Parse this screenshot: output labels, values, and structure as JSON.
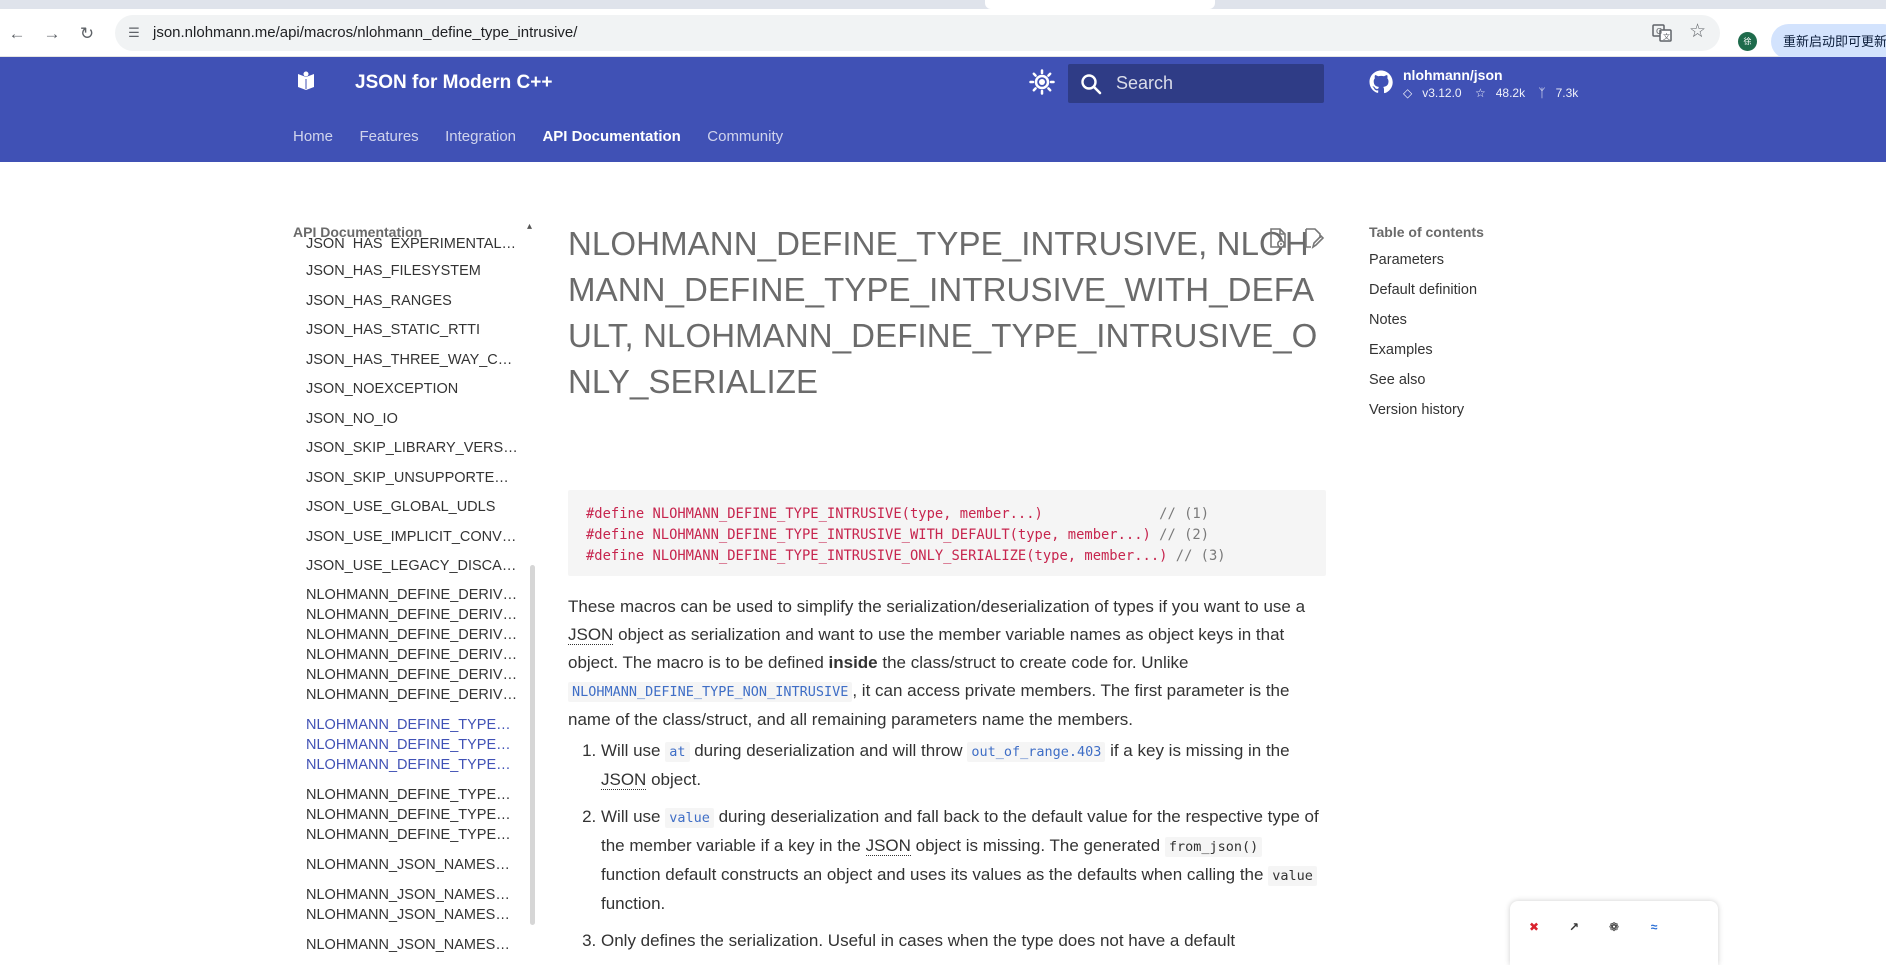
{
  "browser": {
    "url": "json.nlohmann.me/api/macros/nlohmann_define_type_intrusive/",
    "profile_initial": "徐",
    "update_button": "重新启动即可更新"
  },
  "header": {
    "site_title": "JSON for Modern C++",
    "search_placeholder": "Search",
    "repo_name": "nlohmann/json",
    "repo_version": "v3.12.0",
    "repo_stars": "48.2k",
    "repo_forks": "7.3k",
    "tabs": [
      "Home",
      "Features",
      "Integration",
      "API Documentation",
      "Community"
    ],
    "active_tab": "API Documentation"
  },
  "nav": {
    "title": "API Documentation",
    "items": [
      {
        "label": "JSON_HAS_EXPERIMENTAL_FILESYSTEM",
        "current": false
      },
      {
        "label": "JSON_HAS_FILESYSTEM",
        "current": false
      },
      {
        "label": "JSON_HAS_RANGES",
        "current": false
      },
      {
        "label": "JSON_HAS_STATIC_RTTI",
        "current": false
      },
      {
        "label": "JSON_HAS_THREE_WAY_COMPARISON",
        "current": false
      },
      {
        "label": "JSON_NOEXCEPTION",
        "current": false
      },
      {
        "label": "JSON_NO_IO",
        "current": false
      },
      {
        "label": "JSON_SKIP_LIBRARY_VERSION_CHECK",
        "current": false
      },
      {
        "label": "JSON_SKIP_UNSUPPORTED_COMPILER_CHECK",
        "current": false
      },
      {
        "label": "JSON_USE_GLOBAL_UDLS",
        "current": false
      },
      {
        "label": "JSON_USE_IMPLICIT_CONVERSIONS",
        "current": false
      },
      {
        "label": "JSON_USE_LEGACY_DISCARDED_VALUE_COMPARISON",
        "current": false
      },
      {
        "label": "NLOHMANN_DEFINE_DERIVED_TYPE_INTRUSIVE",
        "current": false
      },
      {
        "label": "NLOHMANN_DEFINE_DERIVED_TYPE_INTRUSIVE_WITH_DEFAULT",
        "current": false
      },
      {
        "label": "NLOHMANN_DEFINE_DERIVED_TYPE_INTRUSIVE_ONLY_SERIALIZE",
        "current": false
      },
      {
        "label": "NLOHMANN_DEFINE_DERIVED_TYPE_NON_INTRUSIVE",
        "current": false
      },
      {
        "label": "NLOHMANN_DEFINE_DERIVED_TYPE_NON_INTRUSIVE_WITH_DEFAULT",
        "current": false
      },
      {
        "label": "NLOHMANN_DEFINE_DERIVED_TYPE_NON_INTRUSIVE_ONLY_SERIALIZE",
        "current": false
      },
      {
        "label": "NLOHMANN_DEFINE_TYPE_INTRUSIVE",
        "current": true
      },
      {
        "label": "NLOHMANN_DEFINE_TYPE_INTRUSIVE_WITH_DEFAULT",
        "current": true
      },
      {
        "label": "NLOHMANN_DEFINE_TYPE_INTRUSIVE_ONLY_SERIALIZE",
        "current": true
      },
      {
        "label": "NLOHMANN_DEFINE_TYPE_NON_INTRUSIVE",
        "current": false
      },
      {
        "label": "NLOHMANN_DEFINE_TYPE_NON_INTRUSIVE_WITH_DEFAULT",
        "current": false
      },
      {
        "label": "NLOHMANN_DEFINE_TYPE_NON_INTRUSIVE_ONLY_SERIALIZE",
        "current": false
      },
      {
        "label": "NLOHMANN_JSON_NAMESPACE",
        "current": false
      },
      {
        "label": "NLOHMANN_JSON_NAMESPACE_BEGIN",
        "current": false
      },
      {
        "label": "NLOHMANN_JSON_NAMESPACE_END",
        "current": false
      },
      {
        "label": "NLOHMANN_JSON_NAMESPACE_NO_VERSION",
        "current": false
      }
    ]
  },
  "main": {
    "title": "NLOHMANN_DEFINE_TYPE_INTRUSIVE, NLOHMANN_DEFINE_TYPE_INTRUSIVE_WITH_DEFAULT, NLOHMANN_DEFINE_TYPE_INTRUSIVE_ONLY_SERIALIZE",
    "code_lines": [
      {
        "code": "#define NLOHMANN_DEFINE_TYPE_INTRUSIVE(type, member...)              ",
        "comment": "// (1)"
      },
      {
        "code": "#define NLOHMANN_DEFINE_TYPE_INTRUSIVE_WITH_DEFAULT(type, member...) ",
        "comment": "// (2)"
      },
      {
        "code": "#define NLOHMANN_DEFINE_TYPE_INTRUSIVE_ONLY_SERIALIZE(type, member...) ",
        "comment": "// (3)"
      }
    ],
    "intro": {
      "p1": "These macros can be used to simplify the serialization/deserialization of types if you want to use a ",
      "json1": "JSON",
      "p2": " object as serialization and want to use the member variable names as object keys in that object. The macro is to be defined ",
      "bold": "inside",
      "p3": " the class/struct to create code for. Unlike ",
      "code": "NLOHMANN_DEFINE_TYPE_NON_INTRUSIVE",
      "p4": ", it can access private members. The first parameter is the name of the class/struct, and all remaining parameters name the members."
    },
    "list": {
      "item1": {
        "a": "Will use ",
        "c1": "at",
        "b": " during deserialization and will throw ",
        "c2": "out_of_range.403",
        "d": " if a key is missing in the ",
        "json": "JSON",
        "e": " object."
      },
      "item2": {
        "a": "Will use ",
        "c1": "value",
        "b": " during deserialization and fall back to the default value for the respective type of the member variable if a key in the ",
        "json": "JSON",
        "c": " object is missing. The generated ",
        "c2": "from_json()",
        "d": " function default constructs an object and uses its values as the defaults when calling the ",
        "c3": "value",
        "e": " function."
      },
      "item3": {
        "a": "Only defines the serialization. Useful in cases when the type does not have a default"
      }
    }
  },
  "toc": {
    "title": "Table of contents",
    "items": [
      "Parameters",
      "Default definition",
      "Notes",
      "Examples",
      "See also",
      "Version history"
    ]
  },
  "colors": {
    "header_bg": "#4051b5",
    "accent": "#4051b5",
    "code_text": "#c7254e",
    "inline_code": "#3f6ec6"
  }
}
